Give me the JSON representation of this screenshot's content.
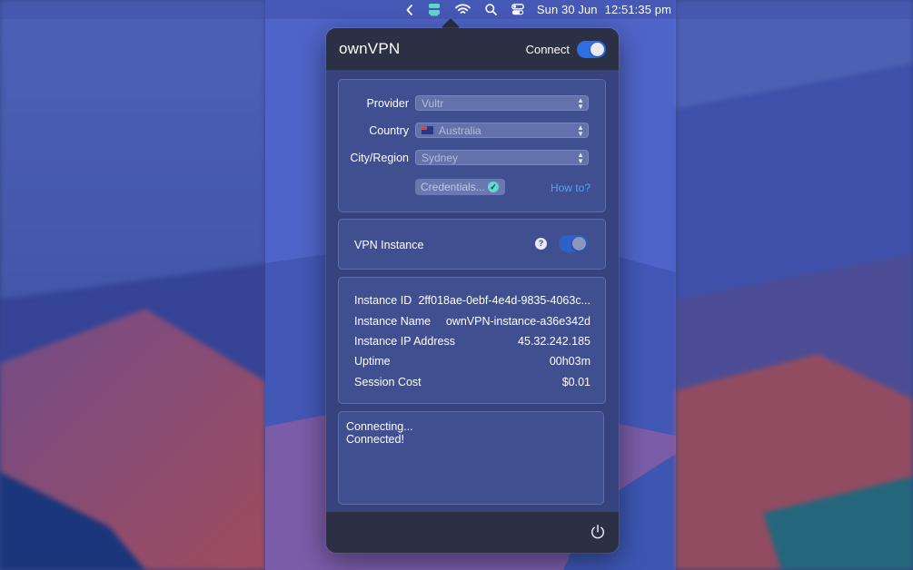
{
  "menubar": {
    "date": "Sun 30 Jun",
    "time": "12:51:35 pm",
    "icons": [
      "chevron-left-icon",
      "ownvpn-menu-icon",
      "wifi-icon",
      "spotlight-search-icon",
      "control-center-icon"
    ]
  },
  "panel": {
    "title": "ownVPN",
    "connect_label": "Connect",
    "connect_on": true,
    "provider": {
      "label": "Provider",
      "value": "Vultr"
    },
    "country": {
      "label": "Country",
      "value": "Australia"
    },
    "city": {
      "label": "City/Region",
      "value": "Sydney"
    },
    "credentials_label": "Credentials...",
    "howto_label": "How to?",
    "vpn_instance_label": "VPN Instance",
    "help_glyph": "?",
    "vpn_instance_on": true,
    "info": [
      {
        "label": "Instance ID",
        "value": "2ff018ae-0ebf-4e4d-9835-4063c..."
      },
      {
        "label": "Instance Name",
        "value": "ownVPN-instance-a36e342d"
      },
      {
        "label": "Instance IP Address",
        "value": "45.32.242.185"
      },
      {
        "label": "Uptime",
        "value": "00h03m"
      },
      {
        "label": "Session Cost",
        "value": "$0.01"
      }
    ],
    "log": [
      "Connecting...",
      "Connected!"
    ]
  },
  "colors": {
    "accent": "#2e6fe2",
    "link": "#5aa2f0",
    "panel_header": "#2b3044",
    "check": "#5fdad0"
  }
}
